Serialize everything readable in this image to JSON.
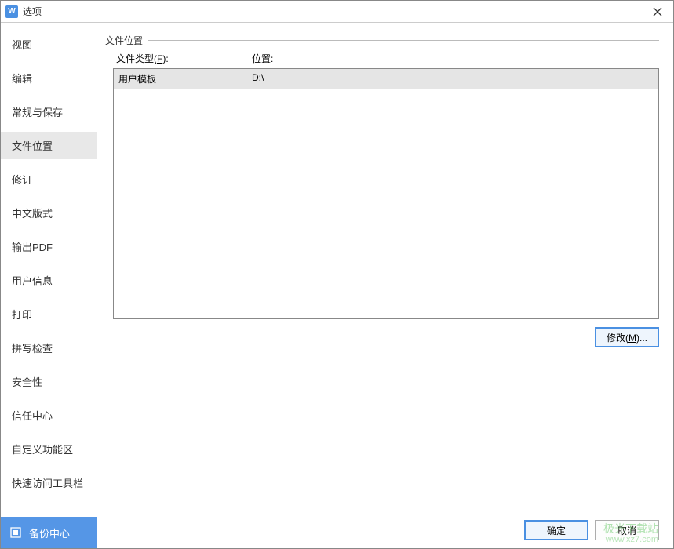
{
  "window": {
    "title": "选项",
    "icon_letter": "W"
  },
  "sidebar": {
    "items": [
      {
        "label": "视图",
        "selected": false
      },
      {
        "label": "编辑",
        "selected": false
      },
      {
        "label": "常规与保存",
        "selected": false
      },
      {
        "label": "文件位置",
        "selected": true
      },
      {
        "label": "修订",
        "selected": false
      },
      {
        "label": "中文版式",
        "selected": false
      },
      {
        "label": "输出PDF",
        "selected": false
      },
      {
        "label": "用户信息",
        "selected": false
      },
      {
        "label": "打印",
        "selected": false
      },
      {
        "label": "拼写检查",
        "selected": false
      },
      {
        "label": "安全性",
        "selected": false
      },
      {
        "label": "信任中心",
        "selected": false
      },
      {
        "label": "自定义功能区",
        "selected": false
      },
      {
        "label": "快速访问工具栏",
        "selected": false
      }
    ],
    "backup_label": "备份中心"
  },
  "main": {
    "section_title": "文件位置",
    "header_type_prefix": "文件类型(",
    "header_type_key": "F",
    "header_type_suffix": "):",
    "header_location": "位置:",
    "rows": [
      {
        "type": "用户模板",
        "location": "D:\\",
        "selected": true
      }
    ],
    "modify_prefix": "修改(",
    "modify_key": "M",
    "modify_suffix": ")..."
  },
  "footer": {
    "ok": "确定",
    "cancel": "取消"
  },
  "watermark": {
    "line1": "极光下载站",
    "line2": "www.xz7.com"
  }
}
